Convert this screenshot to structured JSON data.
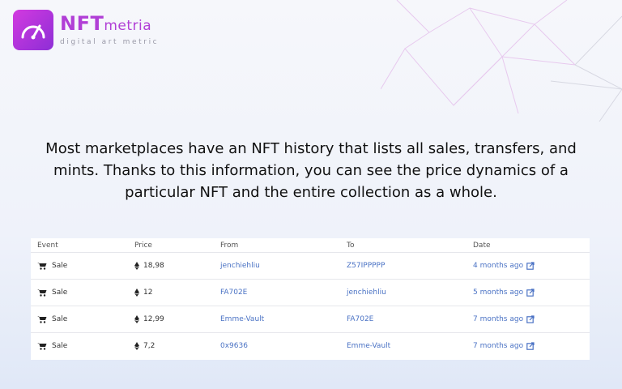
{
  "brand": {
    "name_main": "NFT",
    "name_sub": "metria",
    "tagline": "digital art metric",
    "accent": "#b13fd6"
  },
  "headline": {
    "text": "Most marketplaces have an NFT history that lists all sales, transfers, and mints. Thanks to this information, you can see the price dynamics of a particular NFT and the entire collection as a whole."
  },
  "table": {
    "columns": [
      "Event",
      "Price",
      "From",
      "To",
      "Date"
    ],
    "rows": [
      {
        "event": "Sale",
        "price": "18,98",
        "from": "jenchiehliu",
        "to": "Z57IPPPPP",
        "date": "4 months ago"
      },
      {
        "event": "Sale",
        "price": "12",
        "from": "FA702E",
        "to": "jenchiehliu",
        "date": "5 months ago"
      },
      {
        "event": "Sale",
        "price": "12,99",
        "from": "Emme-Vault",
        "to": "FA702E",
        "date": "7 months ago"
      },
      {
        "event": "Sale",
        "price": "7,2",
        "from": "0x9636",
        "to": "Emme-Vault",
        "date": "7 months ago"
      }
    ],
    "link_color": "#4a72c4"
  },
  "icons": {
    "event": "cart-icon",
    "currency": "eth-icon",
    "date_link": "external-link-icon"
  }
}
